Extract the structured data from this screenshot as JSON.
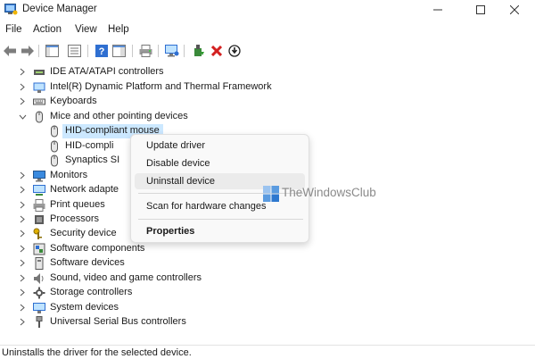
{
  "window": {
    "title": "Device Manager"
  },
  "menu": [
    "File",
    "Action",
    "View",
    "Help"
  ],
  "tree": {
    "items": [
      {
        "label": "IDE ATA/ATAPI controllers",
        "expanded": false
      },
      {
        "label": "Intel(R) Dynamic Platform and Thermal Framework",
        "expanded": false
      },
      {
        "label": "Keyboards",
        "expanded": false
      },
      {
        "label": "Mice and other pointing devices",
        "expanded": true
      },
      {
        "label": "HID-compliant mouse",
        "child": true,
        "selected": true
      },
      {
        "label": "HID-compli",
        "child": true
      },
      {
        "label": "Synaptics SI",
        "child": true
      },
      {
        "label": "Monitors",
        "expanded": false
      },
      {
        "label": "Network adapte",
        "expanded": false
      },
      {
        "label": "Print queues",
        "expanded": false
      },
      {
        "label": "Processors",
        "expanded": false
      },
      {
        "label": "Security device",
        "expanded": false
      },
      {
        "label": "Software components",
        "expanded": false
      },
      {
        "label": "Software devices",
        "expanded": false
      },
      {
        "label": "Sound, video and game controllers",
        "expanded": false
      },
      {
        "label": "Storage controllers",
        "expanded": false
      },
      {
        "label": "System devices",
        "expanded": false
      },
      {
        "label": "Universal Serial Bus controllers",
        "expanded": false
      }
    ]
  },
  "context_menu": {
    "update_driver": "Update driver",
    "disable_device": "Disable device",
    "uninstall_device": "Uninstall device",
    "scan": "Scan for hardware changes",
    "properties": "Properties"
  },
  "watermark": "TheWindowsClub",
  "status": "Uninstalls the driver for the selected device.",
  "colors": {
    "selection": "#cce8ff",
    "uninstall_red": "#d32020",
    "toolbar_blue": "#2f6fd1"
  }
}
